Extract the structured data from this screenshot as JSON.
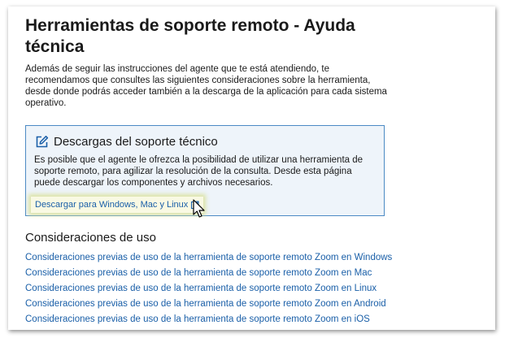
{
  "page": {
    "title": "Herramientas de soporte remoto - Ayuda técnica",
    "intro": "Además de seguir las instrucciones del agente que te está atendiendo, te recomendamos que consultes las siguientes consideraciones sobre la herramienta, desde donde podrás acceder también a la descarga de la aplicación para cada sistema operativo."
  },
  "downloads_box": {
    "icon": "edit-icon",
    "title": "Descargas del soporte técnico",
    "text": "Es posible que el agente le ofrezca la posibilidad de utilizar una herramienta de soporte remoto, para agilizar la resolución de la consulta. Desde esta página puede descargar los componentes y archivos necesarios.",
    "link_label": "Descargar para Windows, Mac y Linux",
    "link_icon": "external-link-icon"
  },
  "considerations": {
    "title": "Consideraciones de uso",
    "links": [
      "Consideraciones previas de uso de la herramienta de soporte remoto Zoom en Windows",
      "Consideraciones previas de uso de la herramienta de soporte remoto Zoom en Mac",
      "Consideraciones previas de uso de la herramienta de soporte remoto Zoom en Linux",
      "Consideraciones previas de uso de la herramienta de soporte remoto Zoom en Android",
      "Consideraciones previas de uso de la herramienta de soporte remoto Zoom en iOS"
    ]
  },
  "colors": {
    "link": "#1a5fa8",
    "box_background": "#eef4fa",
    "box_border": "#4c8ac4",
    "highlight": "#f9f9e3"
  }
}
